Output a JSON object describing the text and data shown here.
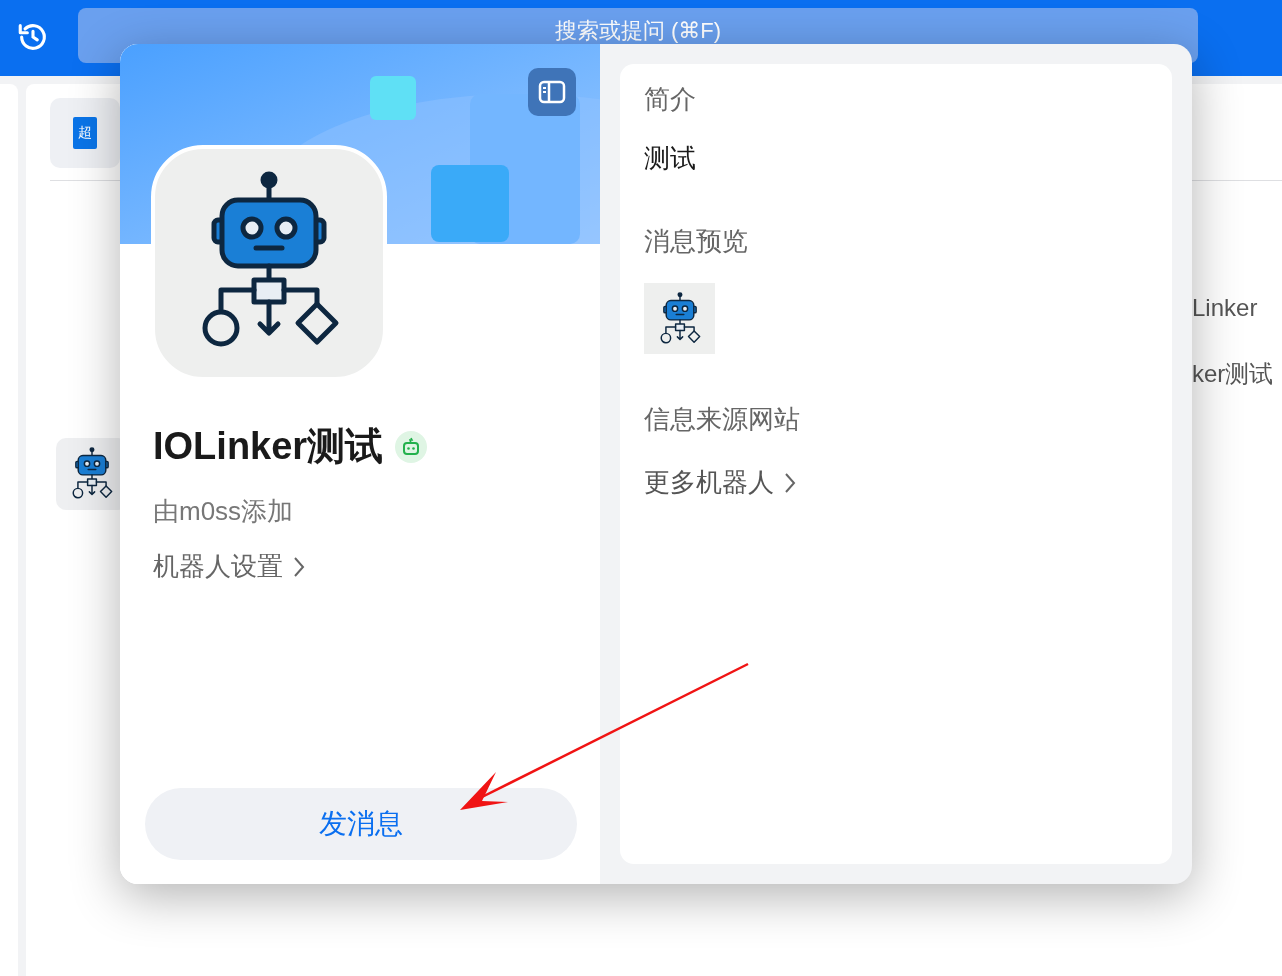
{
  "app": {
    "search": {
      "placeholder": "搜索或提问 (⌘F)"
    },
    "badge": "超",
    "background_items": [
      "Linker",
      "ker测试"
    ]
  },
  "bot_card": {
    "name": "IOLinker测试",
    "added_by": "由m0ss添加",
    "settings_link": "机器人设置",
    "send_button": "发消息"
  },
  "details": {
    "sections": [
      {
        "kind": "text",
        "label": "简介",
        "value": "测试"
      },
      {
        "kind": "preview",
        "label": "消息预览"
      },
      {
        "kind": "label",
        "label": "信息来源网站"
      },
      {
        "kind": "link",
        "label": "更多机器人"
      }
    ]
  },
  "annotation": {
    "kind": "arrow"
  }
}
